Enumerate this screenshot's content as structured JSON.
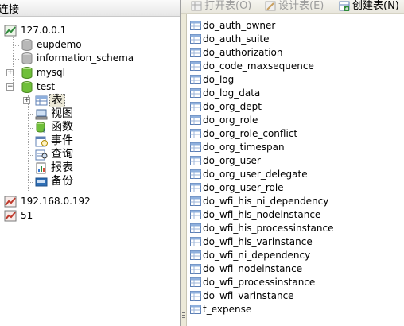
{
  "left_header": {
    "title": "连接"
  },
  "connections": [
    {
      "name": "127.0.0.1",
      "databases": [
        {
          "name": "eupdemo"
        },
        {
          "name": "information_schema"
        },
        {
          "name": "mysql"
        },
        {
          "name": "test",
          "children": [
            {
              "label": "表",
              "icon": "table-icon"
            },
            {
              "label": "视图",
              "icon": "view-icon"
            },
            {
              "label": "函数",
              "icon": "function-icon"
            },
            {
              "label": "事件",
              "icon": "event-icon"
            },
            {
              "label": "查询",
              "icon": "query-icon"
            },
            {
              "label": "报表",
              "icon": "report-icon"
            },
            {
              "label": "备份",
              "icon": "backup-icon"
            }
          ]
        }
      ]
    },
    {
      "name": "192.168.0.192"
    },
    {
      "name": "51"
    }
  ],
  "toolbar": {
    "open_table": "打开表(O)",
    "design_table": "设计表(E)",
    "create_table": "创建表(N)"
  },
  "tables": [
    "do_auth_owner",
    "do_auth_suite",
    "do_authorization",
    "do_code_maxsequence",
    "do_log",
    "do_log_data",
    "do_org_dept",
    "do_org_role",
    "do_org_role_conflict",
    "do_org_timespan",
    "do_org_user",
    "do_org_user_delegate",
    "do_org_user_role",
    "do_wfi_his_ni_dependency",
    "do_wfi_his_nodeinstance",
    "do_wfi_his_processinstance",
    "do_wfi_his_varinstance",
    "do_wfi_ni_dependency",
    "do_wfi_nodeinstance",
    "do_wfi_processinstance",
    "do_wfi_varinstance",
    "t_expense"
  ],
  "colors": {
    "selection": "#316ac5",
    "db_open": "#6fbf3a",
    "db_closed": "#b8b8b8",
    "connection_ok": "#2e8b3a",
    "connection_off": "#c0392b"
  }
}
